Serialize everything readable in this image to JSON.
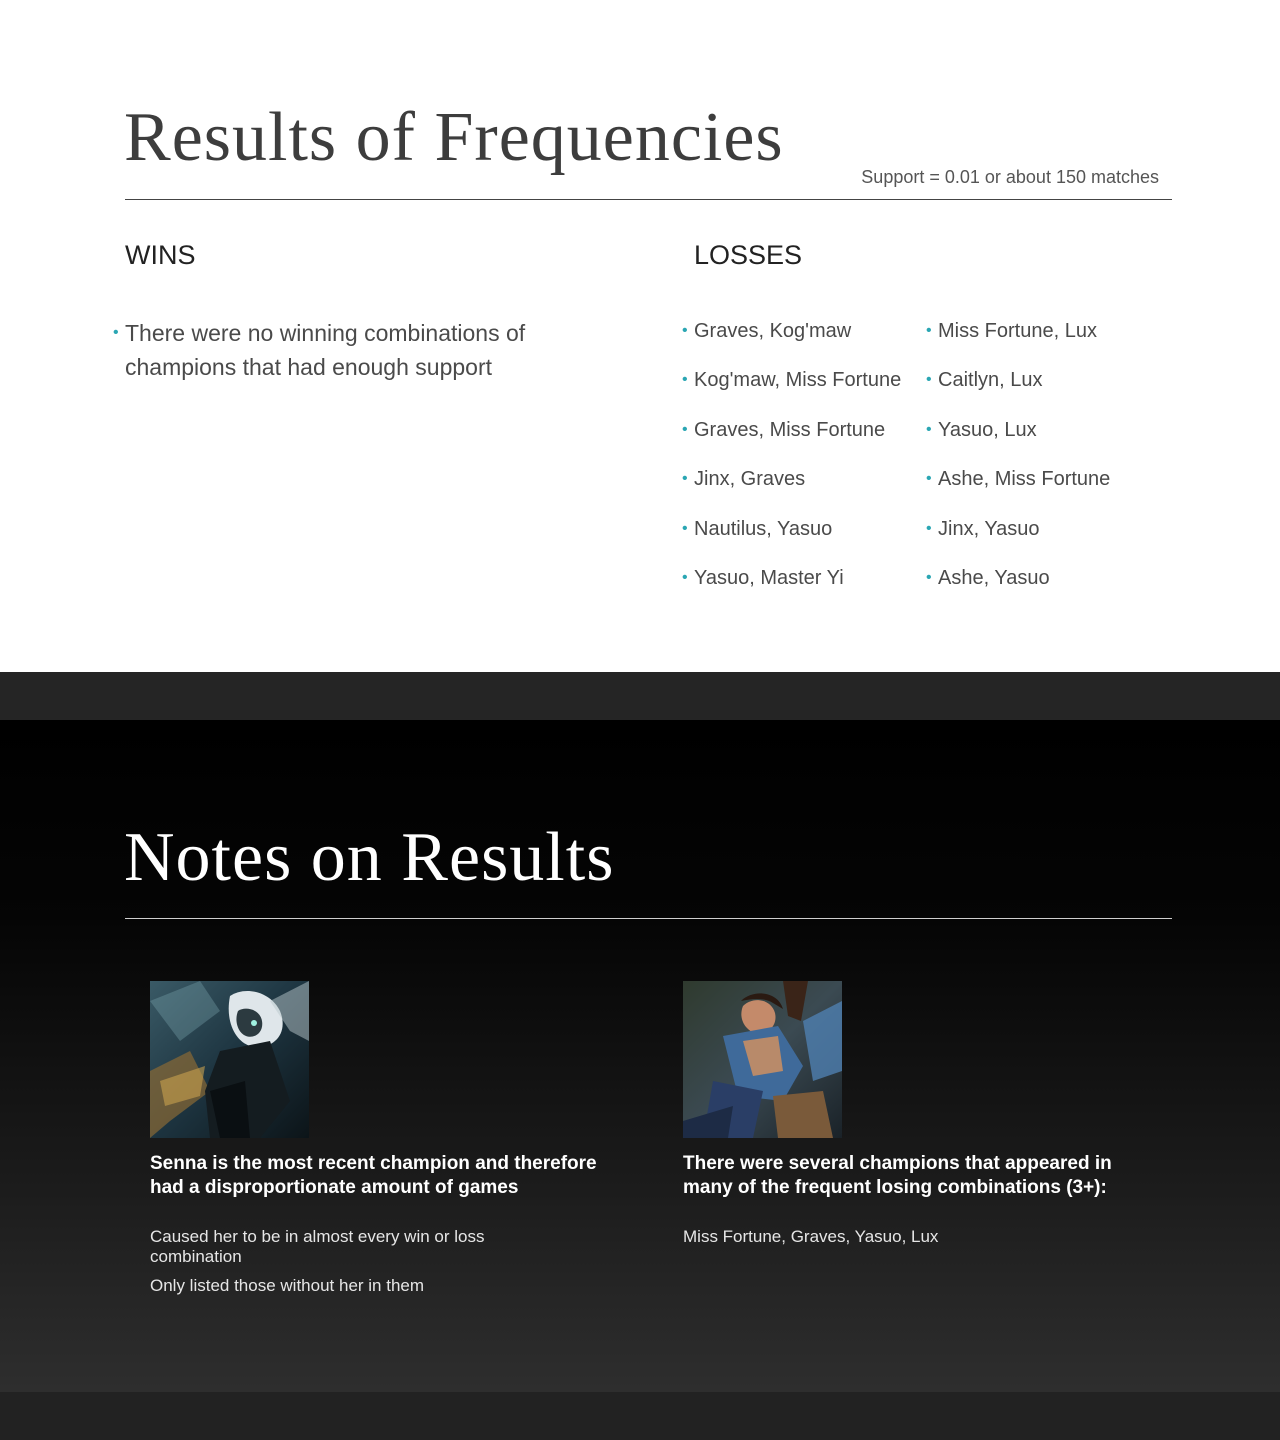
{
  "slide1": {
    "title": "Results of Frequencies",
    "support_note": "Support = 0.01 or about 150 matches",
    "wins": {
      "heading": "WINS",
      "items": [
        "There were no winning combinations of champions that had enough support"
      ]
    },
    "losses": {
      "heading": "LOSSES",
      "col1": [
        "Graves, Kog'maw",
        "Kog'maw, Miss Fortune",
        "Graves, Miss Fortune",
        "Jinx, Graves",
        "Nautilus, Yasuo",
        "Yasuo, Master Yi"
      ],
      "col2": [
        "Miss Fortune, Lux",
        "Caitlyn, Lux",
        "Yasuo, Lux",
        "Ashe, Miss Fortune",
        "Jinx, Yasuo",
        "Ashe, Yasuo"
      ]
    }
  },
  "slide2": {
    "title": "Notes on Results",
    "left": {
      "heading": "Senna is the most recent champion and therefore had a disproportionate amount of games",
      "lines": [
        "Caused her to be in almost every win or loss combination",
        "Only listed those without her in them"
      ]
    },
    "right": {
      "heading": "There were several champions that appeared in many of the frequent losing combinations (3+):",
      "lines": [
        "Miss Fortune, Graves, Yasuo, Lux"
      ]
    }
  },
  "colors": {
    "bullet_accent": "#2aa6b3",
    "title_dark": "#3d3d3d"
  }
}
